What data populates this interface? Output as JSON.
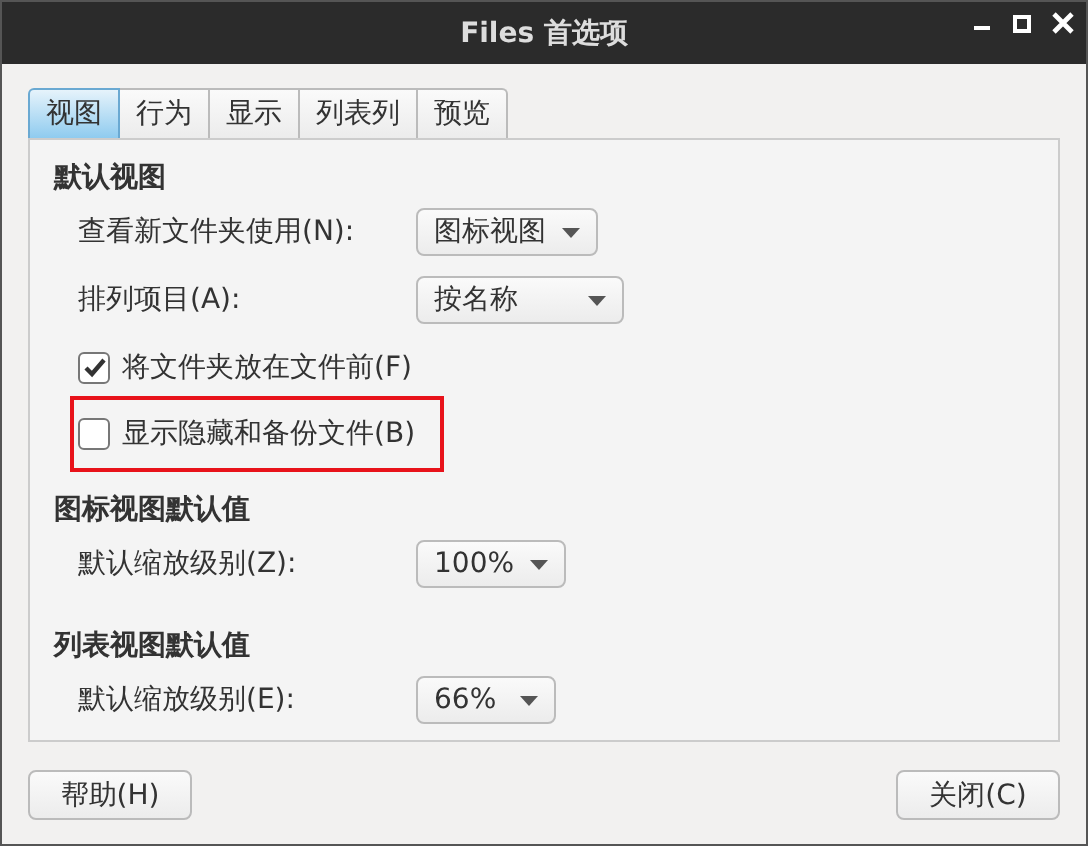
{
  "window": {
    "title": "Files 首选项"
  },
  "tabs": [
    {
      "label": "视图",
      "selected": true
    },
    {
      "label": "行为",
      "selected": false
    },
    {
      "label": "显示",
      "selected": false
    },
    {
      "label": "列表列",
      "selected": false
    },
    {
      "label": "预览",
      "selected": false
    }
  ],
  "sections": [
    {
      "heading": "默认视图",
      "items": [
        {
          "kind": "combo",
          "label": "查看新文件夹使用(N):",
          "value": "图标视图",
          "wide": false
        },
        {
          "kind": "combo",
          "label": "排列项目(A):",
          "value": "按名称",
          "wide": true
        },
        {
          "kind": "checkbox",
          "label": "将文件夹放在文件前(F)",
          "checked": true,
          "highlighted": false
        },
        {
          "kind": "checkbox",
          "label": "显示隐藏和备份文件(B)",
          "checked": false,
          "highlighted": true
        }
      ]
    },
    {
      "heading": "图标视图默认值",
      "items": [
        {
          "kind": "combo",
          "label": "默认缩放级别(Z):",
          "value": "100%",
          "wide": false
        }
      ]
    },
    {
      "heading": "列表视图默认值",
      "items": [
        {
          "kind": "combo",
          "label": "默认缩放级别(E):",
          "value": "66%",
          "wide": false
        }
      ]
    }
  ],
  "buttons": [
    "帮助(H)",
    "关闭(C)"
  ]
}
